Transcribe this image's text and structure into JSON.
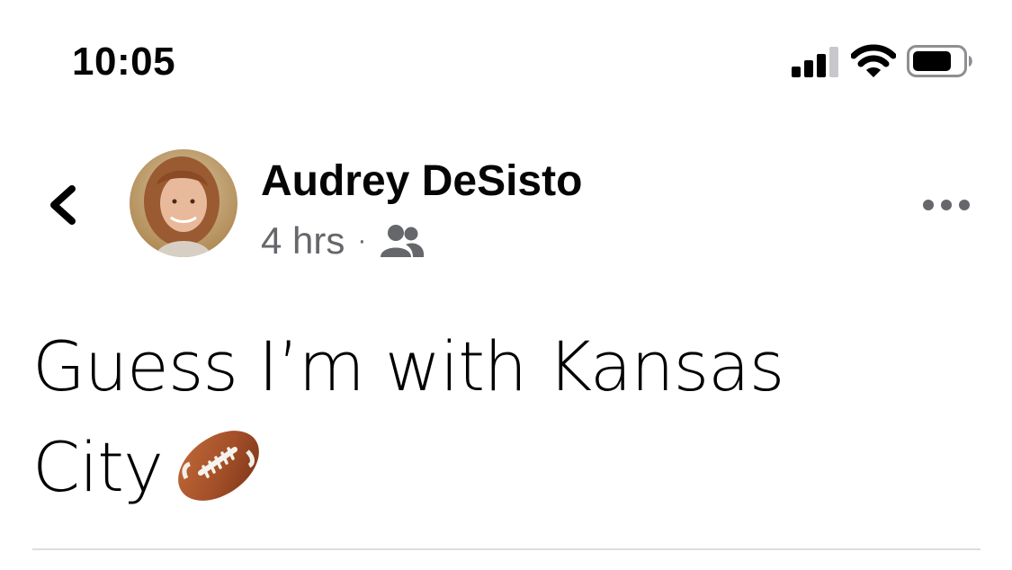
{
  "status_bar": {
    "time": "10:05",
    "icons": [
      "signal-icon",
      "wifi-icon",
      "battery-icon"
    ]
  },
  "post": {
    "author": "Audrey DeSisto",
    "time_ago": "4 hrs",
    "separator": "·",
    "audience_icon": "friends-icon",
    "text_lines": [
      "Guess I’m with Kansas",
      "City"
    ],
    "emoji": "american-football-icon"
  },
  "colors": {
    "text": "#050505",
    "meta_gray": "#65676b",
    "divider": "#dadde1",
    "background": "#ffffff"
  }
}
